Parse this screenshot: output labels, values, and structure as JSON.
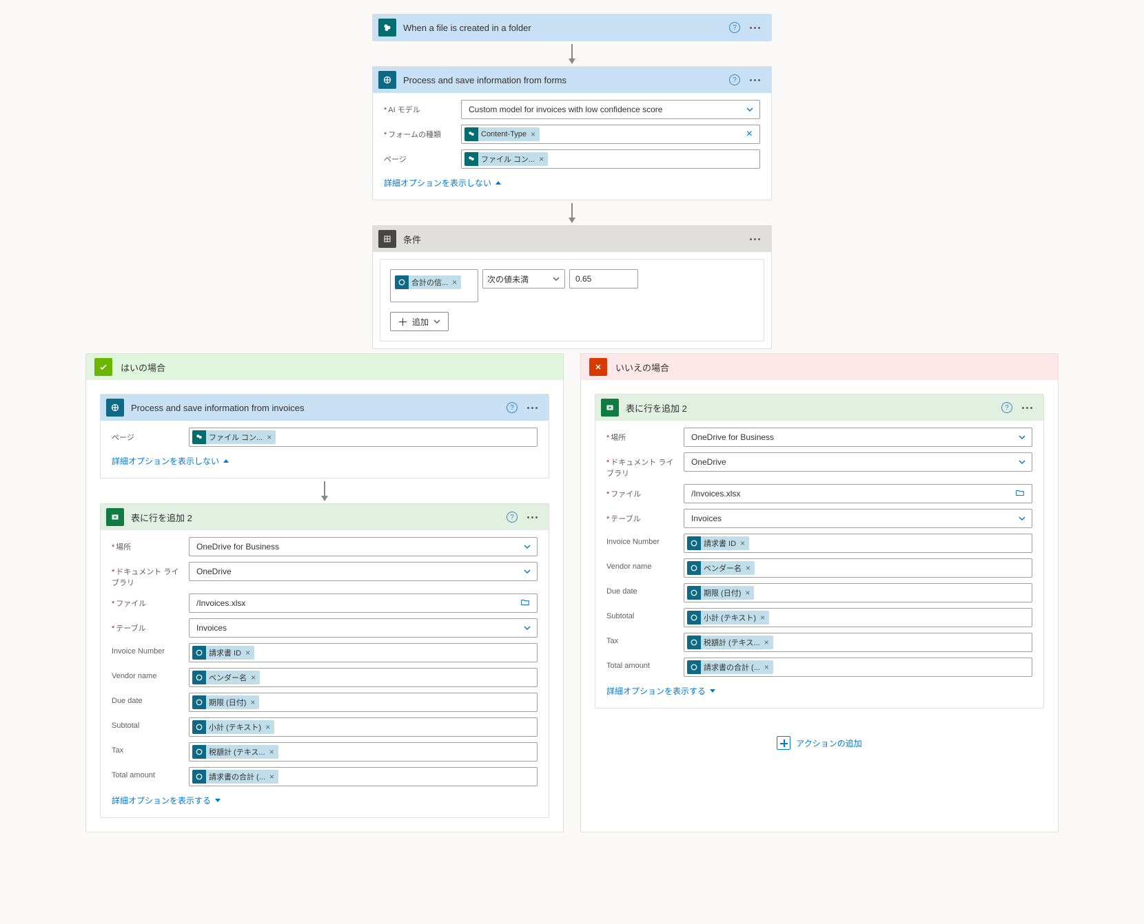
{
  "trigger": {
    "title": "When a file is created in a folder"
  },
  "ai1": {
    "title": "Process and save information from forms",
    "labels": {
      "model": "AI モデル",
      "formType": "フォームの種類",
      "page": "ページ"
    },
    "modelValue": "Custom model for invoices with low confidence score",
    "formTypeToken": "Content-Type",
    "pageToken": "ファイル コン...",
    "advToggle": "詳細オプションを表示しない"
  },
  "condition": {
    "title": "条件",
    "leftToken": "合計の信...",
    "operator": "次の値未満",
    "value": "0.65",
    "addLabel": "追加"
  },
  "branches": {
    "yes": "はいの場合",
    "no": "いいえの場合",
    "addAction": "アクションの追加"
  },
  "aiYes": {
    "title": "Process and save information from invoices",
    "pageLabel": "ページ",
    "pageToken": "ファイル コン...",
    "advToggle": "詳細オプションを表示しない"
  },
  "excel": {
    "title": "表に行を追加 2",
    "labels": {
      "location": "場所",
      "library": "ドキュメント ライブラリ",
      "file": "ファイル",
      "table": "テーブル",
      "invoiceNumber": "Invoice Number",
      "vendor": "Vendor name",
      "due": "Due date",
      "subtotal": "Subtotal",
      "tax": "Tax",
      "total": "Total amount"
    },
    "values": {
      "location": "OneDrive for Business",
      "library": "OneDrive",
      "file": "/Invoices.xlsx",
      "table": "Invoices"
    },
    "tokens": {
      "invoiceNumber": "請求書 ID",
      "vendor": "ベンダー名",
      "due": "期限 (日付)",
      "subtotal": "小計 (テキスト)",
      "tax": "税額計 (テキス...",
      "total": "請求書の合計 (..."
    },
    "advShow": "詳細オプションを表示する"
  }
}
